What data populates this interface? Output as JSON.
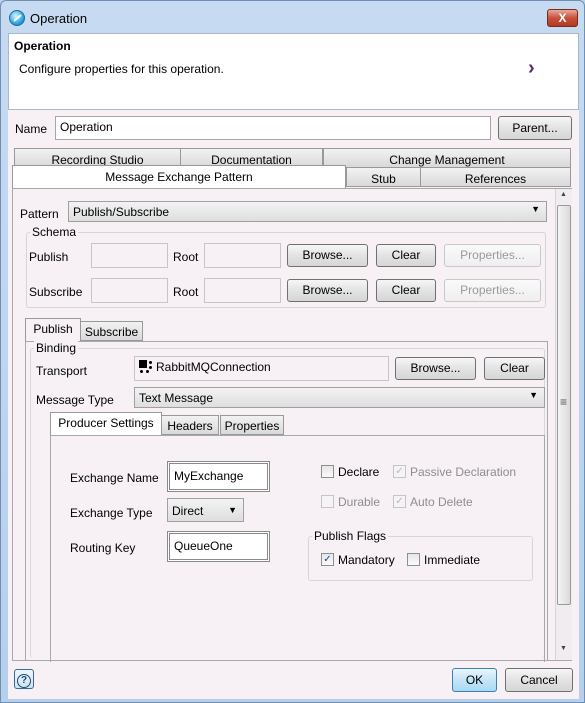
{
  "window": {
    "title": "Operation",
    "close_label": "X"
  },
  "header": {
    "title": "Operation",
    "description": "Configure properties for this operation.",
    "arrow": "›"
  },
  "name_row": {
    "label": "Name",
    "value": "Operation",
    "parent_button": "Parent..."
  },
  "main_tabs": {
    "row1": [
      "Recording Studio",
      "Documentation",
      "Change Management"
    ],
    "row2": [
      "Message Exchange Pattern",
      "Stub",
      "References"
    ],
    "active": "Message Exchange Pattern"
  },
  "pattern": {
    "label": "Pattern",
    "value": "Publish/Subscribe"
  },
  "schema": {
    "title": "Schema",
    "rows": [
      {
        "label": "Publish",
        "value": "",
        "root_label": "Root",
        "root_value": "",
        "browse": "Browse...",
        "clear": "Clear",
        "properties": "Properties..."
      },
      {
        "label": "Subscribe",
        "value": "",
        "root_label": "Root",
        "root_value": "",
        "browse": "Browse...",
        "clear": "Clear",
        "properties": "Properties..."
      }
    ]
  },
  "sub_tabs": {
    "items": [
      "Publish",
      "Subscribe"
    ],
    "active": "Publish"
  },
  "binding": {
    "title": "Binding",
    "transport_label": "Transport",
    "transport_value": "RabbitMQConnection",
    "transport_icon": "connection-icon",
    "browse": "Browse...",
    "clear": "Clear",
    "message_type_label": "Message Type",
    "message_type_value": "Text Message"
  },
  "inner_tabs": {
    "items": [
      "Producer Settings",
      "Headers",
      "Properties"
    ],
    "active": "Producer Settings"
  },
  "producer": {
    "exchange_name_label": "Exchange Name",
    "exchange_name_value": "MyExchange",
    "exchange_type_label": "Exchange Type",
    "exchange_type_value": "Direct",
    "routing_key_label": "Routing Key",
    "routing_key_value": "QueueOne",
    "checkboxes": {
      "declare": {
        "label": "Declare",
        "checked": false,
        "enabled": true
      },
      "passive": {
        "label": "Passive Declaration",
        "checked": true,
        "enabled": false
      },
      "durable": {
        "label": "Durable",
        "checked": false,
        "enabled": false
      },
      "auto_delete": {
        "label": "Auto Delete",
        "checked": true,
        "enabled": false
      }
    },
    "publish_flags": {
      "title": "Publish Flags",
      "mandatory": {
        "label": "Mandatory",
        "checked": true
      },
      "immediate": {
        "label": "Immediate",
        "checked": false
      }
    }
  },
  "footer": {
    "help": "?",
    "ok": "OK",
    "cancel": "Cancel"
  },
  "glyphs": {
    "check": "✓",
    "down": "▼",
    "up": "▲",
    "grip": "≡"
  }
}
